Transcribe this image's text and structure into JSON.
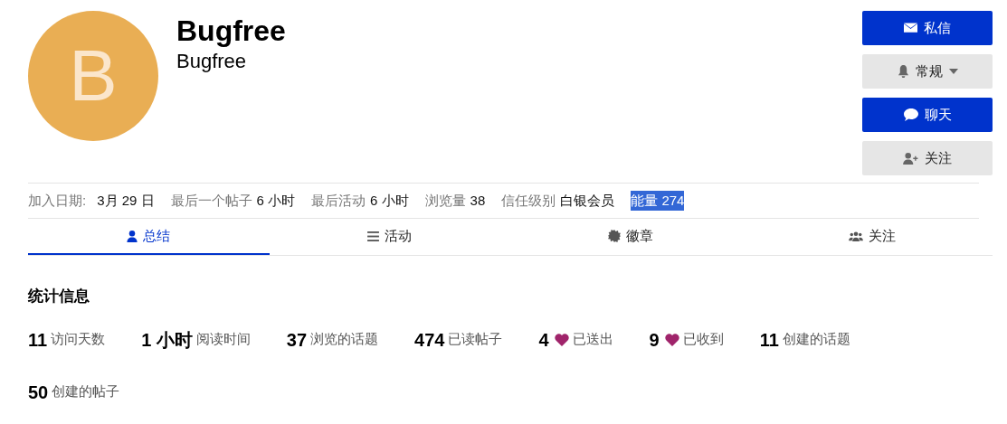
{
  "profile": {
    "avatar_letter": "B",
    "name": "Bugfree",
    "username": "Bugfree"
  },
  "actions": [
    {
      "label": "私信",
      "kind": "primary",
      "dropdown": false
    },
    {
      "label": "常规",
      "kind": "secondary",
      "dropdown": true
    },
    {
      "label": "聊天",
      "kind": "primary",
      "dropdown": false
    },
    {
      "label": "关注",
      "kind": "secondary",
      "dropdown": false
    }
  ],
  "meta": [
    {
      "label": "加入日期:",
      "value": "3月 29 日",
      "highlighted": false
    },
    {
      "label": "最后一个帖子",
      "value": "6 小时",
      "highlighted": false
    },
    {
      "label": "最后活动",
      "value": "6 小时",
      "highlighted": false
    },
    {
      "label": "浏览量",
      "value": "38",
      "highlighted": false
    },
    {
      "label": "信任级别",
      "value": "白银会员",
      "highlighted": false
    },
    {
      "label": "能量",
      "value": "274",
      "highlighted": true
    }
  ],
  "tabs": [
    {
      "label": "总结",
      "selected": true
    },
    {
      "label": "活动",
      "selected": false
    },
    {
      "label": "徽章",
      "selected": false
    },
    {
      "label": "关注",
      "selected": false
    }
  ],
  "stats_title": "统计信息",
  "stats": [
    {
      "value": "11",
      "label": "访问天数",
      "heart": false
    },
    {
      "value": "1 小时",
      "label": "阅读时间",
      "heart": false
    },
    {
      "value": "37",
      "label": "浏览的话题",
      "heart": false
    },
    {
      "value": "474",
      "label": "已读帖子",
      "heart": false
    },
    {
      "value": "4",
      "label": "已送出",
      "heart": true
    },
    {
      "value": "9",
      "label": "已收到",
      "heart": true
    },
    {
      "value": "11",
      "label": "创建的话题",
      "heart": false
    },
    {
      "value": "50",
      "label": "创建的帖子",
      "heart": false
    }
  ]
}
